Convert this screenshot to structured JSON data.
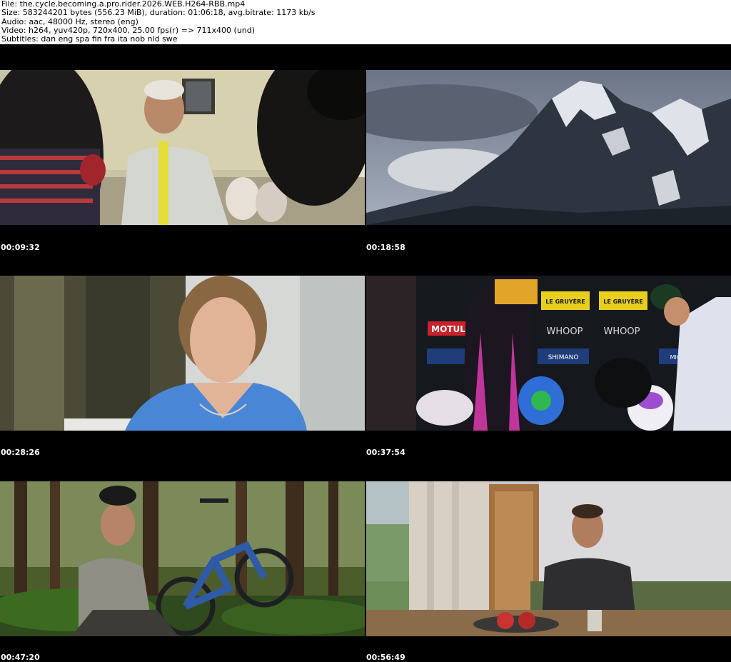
{
  "header": {
    "file": "File: the.cycle.becoming.a.pro.rider.2026.WEB.H264-RBB.mp4",
    "size": "Size: 583244201 bytes (556.23 MiB), duration: 01:06:18, avg.bitrate: 1173 kb/s",
    "audio": "Audio: aac, 48000 Hz, stereo (eng)",
    "video": "Video: h264, yuv420p, 720x400, 25.00 fps(r) => 711x400 (und)",
    "subtitles": "Subtitles: dan eng spa fin fra ita nob nld swe"
  },
  "frames": [
    {
      "timestamp": "00:09:32",
      "scene": "crowd-interview"
    },
    {
      "timestamp": "00:18:58",
      "scene": "mountain"
    },
    {
      "timestamp": "00:28:26",
      "scene": "woman-interview"
    },
    {
      "timestamp": "00:37:54",
      "scene": "podium"
    },
    {
      "timestamp": "00:47:20",
      "scene": "forest-bike"
    },
    {
      "timestamp": "00:56:49",
      "scene": "man-table"
    }
  ],
  "podium_signs": {
    "sign_1": "LE GRUYÈRE",
    "sign_2": "LE GRUYÈRE",
    "motul": "MOTUL",
    "whoop_1": "WHOOP",
    "whoop_2": "WHOOP",
    "shimano": "SHIMANO",
    "michelin": "MICHELIN"
  },
  "colors": {
    "background": "#000000",
    "header_bg": "#ffffff",
    "timestamp": "#ffffff"
  }
}
